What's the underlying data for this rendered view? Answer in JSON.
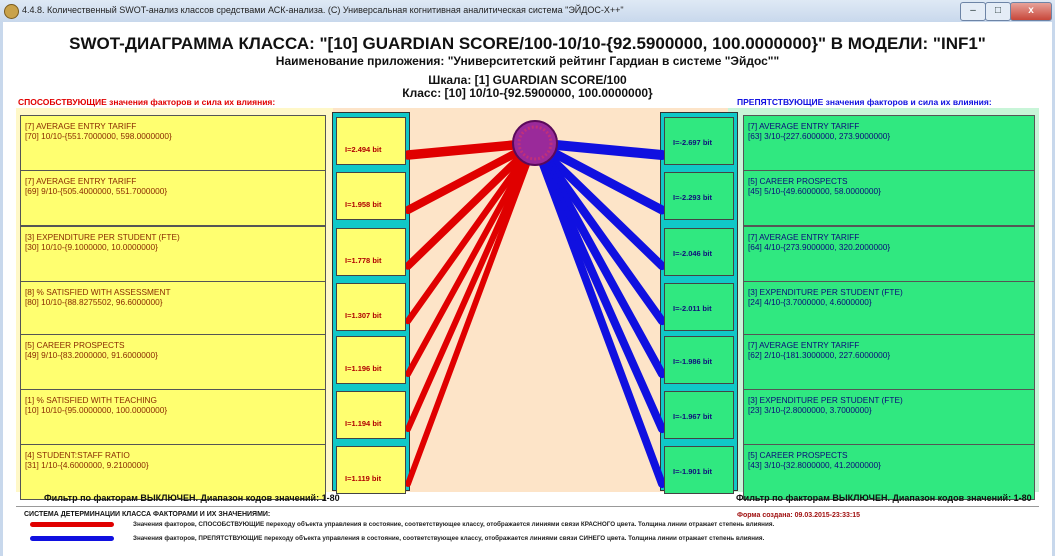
{
  "window": {
    "title": "4.4.8. Количественный SWOT-анализ классов средствами АСК-анализа.  (C) Универсальная когнитивная аналитическая система \"ЭЙДОС-Х++\"",
    "btn_min": "–",
    "btn_max": "□",
    "btn_close": "x"
  },
  "header": {
    "title": "SWOT-ДИАГРАММА КЛАССА: \"[10] GUARDIAN SCORE/100-10/10-{92.5900000, 100.0000000}\" В МОДЕЛИ: \"INF1\"",
    "app_name": "Наименование приложения: \"Университетский рейтинг Гардиан в системе \"Эйдос\"\"",
    "scale": "Шкала: [1] GUARDIAN SCORE/100",
    "class": "Класс: [10] 10/10-{92.5900000, 100.0000000}"
  },
  "left_label": "СПОСОБСТВУЮЩИЕ значения факторов и сила их влияния:",
  "right_label": "ПРЕПЯТСТВУЮЩИЕ значения факторов и сила их влияния:",
  "promoting": [
    {
      "factor": "[7] AVERAGE ENTRY TARIFF",
      "value": "[70] 10/10-{551.7000000, 598.0000000}",
      "info": "I=2.494 bit",
      "weight": 2.494
    },
    {
      "factor": "[7] AVERAGE ENTRY TARIFF",
      "value": "[69] 9/10-{505.4000000, 551.7000000}",
      "info": "I=1.958 bit",
      "weight": 1.958
    },
    {
      "factor": "[3] EXPENDITURE PER STUDENT (FTE)",
      "value": "[30] 10/10-{9.1000000, 10.0000000}",
      "info": "I=1.778 bit",
      "weight": 1.778
    },
    {
      "factor": "[8] % SATISFIED WITH ASSESSMENT",
      "value": "[80] 10/10-{88.8275502, 96.6000000}",
      "info": "I=1.307 bit",
      "weight": 1.307
    },
    {
      "factor": "[5] CAREER PROSPECTS",
      "value": "[49] 9/10-{83.2000000, 91.6000000}",
      "info": "I=1.196 bit",
      "weight": 1.196
    },
    {
      "factor": "[1] % SATISFIED WITH TEACHING",
      "value": "[10] 10/10-{95.0000000, 100.0000000}",
      "info": "I=1.194 bit",
      "weight": 1.194
    },
    {
      "factor": "[4] STUDENT:STAFF RATIO",
      "value": "[31] 1/10-{4.6000000, 9.2100000}",
      "info": "I=1.119 bit",
      "weight": 1.119
    }
  ],
  "hindering": [
    {
      "factor": "[7] AVERAGE ENTRY TARIFF",
      "value": "[63] 3/10-{227.6000000, 273.9000000}",
      "info": "I=-2.697 bit",
      "weight": 2.697
    },
    {
      "factor": "[5] CAREER PROSPECTS",
      "value": "[45] 5/10-{49.6000000, 58.0000000}",
      "info": "I=-2.293 bit",
      "weight": 2.293
    },
    {
      "factor": "[7] AVERAGE ENTRY TARIFF",
      "value": "[64] 4/10-{273.9000000, 320.2000000}",
      "info": "I=-2.046 bit",
      "weight": 2.046
    },
    {
      "factor": "[3] EXPENDITURE PER STUDENT (FTE)",
      "value": "[24] 4/10-{3.7000000, 4.6000000}",
      "info": "I=-2.011 bit",
      "weight": 2.011
    },
    {
      "factor": "[7] AVERAGE ENTRY TARIFF",
      "value": "[62] 2/10-{181.3000000, 227.6000000}",
      "info": "I=-1.986 bit",
      "weight": 1.986
    },
    {
      "factor": "[3] EXPENDITURE PER STUDENT (FTE)",
      "value": "[23] 3/10-{2.8000000, 3.7000000}",
      "info": "I=-1.967 bit",
      "weight": 1.967
    },
    {
      "factor": "[5] CAREER PROSPECTS",
      "value": "[43] 3/10-{32.8000000, 41.2000000}",
      "info": "I=-1.901 bit",
      "weight": 1.901
    }
  ],
  "filter_left": "Фильтр по факторам ВЫКЛЮЧЕН. Диапазон кодов значений: 1-80",
  "filter_right": "Фильтр по факторам ВЫКЛЮЧЕН. Диапазон кодов значений: 1-80",
  "legend": {
    "title": "СИСТЕМА ДЕТЕРМИНАЦИИ КЛАССА ФАКТОРАМИ И ИХ ЗНАЧЕНИЯМИ:",
    "created": "Форма создана: 09.03.2015-23:33:15",
    "red_text": "Значения факторов, СПОСОБСТВУЮЩИЕ переходу объекта управления в состояние, соответствующее классу, отображается линиями связи КРАСНОГО цвета. Толщина линии отражает степень влияния.",
    "blue_text": "Значения факторов, ПРЕПЯТСТВУЮЩИЕ переходу объекта управления в состояние, соответствующее классу, отображается линиями связи СИНЕГО цвета. Толщина линии отражает степень влияния."
  },
  "colors": {
    "promoting": "#e00000",
    "hindering": "#1010e0",
    "class_node": "#9a2a9a"
  }
}
